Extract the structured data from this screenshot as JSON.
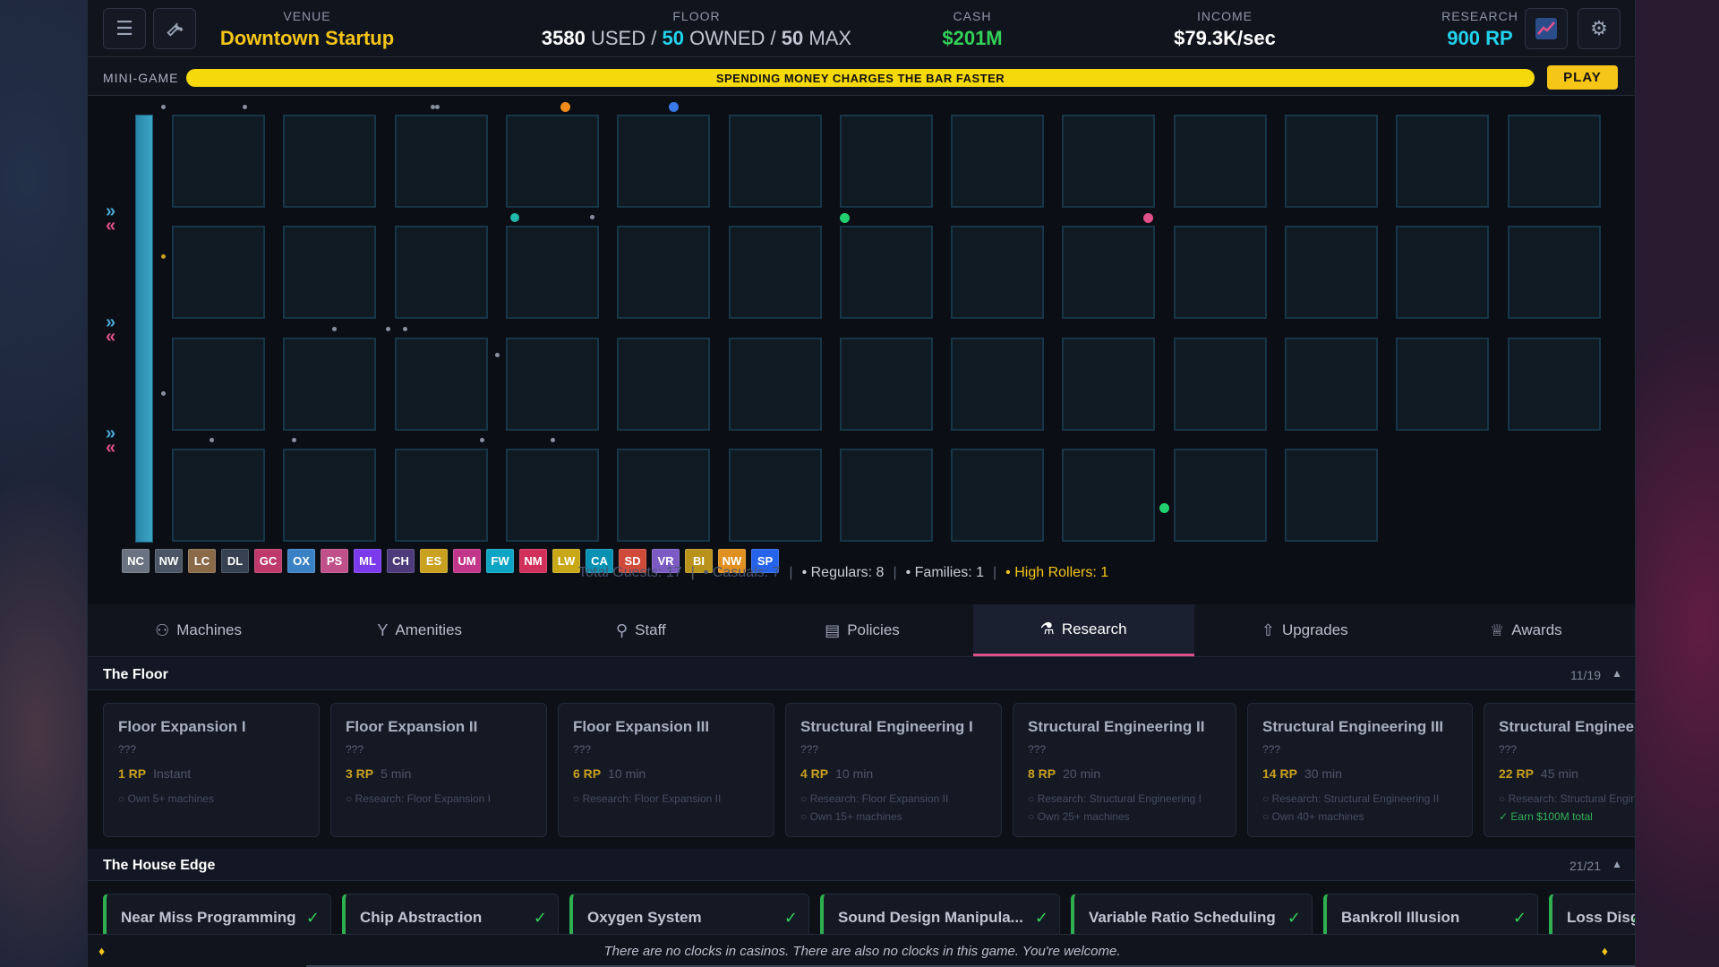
{
  "header": {
    "menu_icon": "hamburger-icon",
    "tools_icon": "wrench-icon",
    "chart_icon": "line-chart-icon",
    "settings_icon": "gear-icon",
    "venue": {
      "label": "VENUE",
      "value": "Downtown Startup"
    },
    "floor": {
      "label": "FLOOR",
      "used": "3580",
      "used_label": "USED /",
      "owned": "50",
      "owned_label": "OWNED /",
      "max": "50",
      "max_label": "MAX"
    },
    "cash": {
      "label": "CASH",
      "value": "$201M"
    },
    "income": {
      "label": "INCOME",
      "value": "$79.3K/sec"
    },
    "research": {
      "label": "RESEARCH",
      "value": "900 RP"
    }
  },
  "minigame": {
    "label": "MINI-GAME",
    "bar_text": "SPENDING MONEY CHARGES THE BAR FASTER",
    "play_label": "PLAY",
    "bar_color": "#f5d90a"
  },
  "floor_grid": {
    "rows": 4,
    "cols_full": 13,
    "last_row_cols": 11,
    "machine_chips": [
      {
        "code": "NC",
        "color": "#6b7280"
      },
      {
        "code": "NW",
        "color": "#4b5563"
      },
      {
        "code": "LC",
        "color": "#8b6a4a"
      },
      {
        "code": "DL",
        "color": "#374151"
      },
      {
        "code": "GC",
        "color": "#be3a6a"
      },
      {
        "code": "OX",
        "color": "#3b82c4"
      },
      {
        "code": "PS",
        "color": "#c0508a"
      },
      {
        "code": "ML",
        "color": "#7c3aed"
      },
      {
        "code": "CH",
        "color": "#4c3a7a"
      },
      {
        "code": "ES",
        "color": "#c9a020"
      },
      {
        "code": "UM",
        "color": "#c2368a"
      },
      {
        "code": "FW",
        "color": "#0ea5c4"
      },
      {
        "code": "NM",
        "color": "#d0305a"
      },
      {
        "code": "LW",
        "color": "#c9a818"
      },
      {
        "code": "CA",
        "color": "#0891b2"
      },
      {
        "code": "SD",
        "color": "#d04a3a"
      },
      {
        "code": "VR",
        "color": "#7c5ac4"
      },
      {
        "code": "BI",
        "color": "#b8921a"
      },
      {
        "code": "NW",
        "color": "#e09020"
      },
      {
        "code": "SP",
        "color": "#2563eb"
      }
    ],
    "guests": {
      "total": "Total Guests: 17",
      "casuals": "• Casuals: 7",
      "regulars": "• Regulars: 8",
      "families": "• Families: 1",
      "high_rollers": "• High Rollers: 1"
    }
  },
  "tabs": [
    {
      "label": "Machines",
      "icon": "slot-machine-icon"
    },
    {
      "label": "Amenities",
      "icon": "cocktail-icon"
    },
    {
      "label": "Staff",
      "icon": "person-icon"
    },
    {
      "label": "Policies",
      "icon": "clipboard-icon"
    },
    {
      "label": "Research",
      "icon": "flask-icon",
      "active": true
    },
    {
      "label": "Upgrades",
      "icon": "arrow-up-icon"
    },
    {
      "label": "Awards",
      "icon": "trophy-icon"
    }
  ],
  "sections": {
    "floor": {
      "title": "The Floor",
      "count": "11/19",
      "cards": [
        {
          "title": "Floor Expansion I",
          "desc": "???",
          "rp": "1 RP",
          "time": "Instant",
          "reqs": [
            "○ Own 5+ machines"
          ]
        },
        {
          "title": "Floor Expansion II",
          "desc": "???",
          "rp": "3 RP",
          "time": "5 min",
          "reqs": [
            "○ Research: Floor Expansion I"
          ]
        },
        {
          "title": "Floor Expansion III",
          "desc": "???",
          "rp": "6 RP",
          "time": "10 min",
          "reqs": [
            "○ Research: Floor Expansion II"
          ]
        },
        {
          "title": "Structural Engineering I",
          "desc": "???",
          "rp": "4 RP",
          "time": "10 min",
          "reqs": [
            "○ Research: Floor Expansion II",
            "○ Own 15+ machines"
          ]
        },
        {
          "title": "Structural Engineering II",
          "desc": "???",
          "rp": "8 RP",
          "time": "20 min",
          "reqs": [
            "○ Research: Structural Engineering I",
            "○ Own 25+ machines"
          ]
        },
        {
          "title": "Structural Engineering III",
          "desc": "???",
          "rp": "14 RP",
          "time": "30 min",
          "reqs": [
            "○ Research: Structural Engineering II",
            "○ Own 40+ machines"
          ]
        },
        {
          "title": "Structural Engineering IV",
          "desc": "???",
          "rp": "22 RP",
          "time": "45 min",
          "reqs": [
            "○ Research: Structural Engineering III"
          ],
          "req_ok": "✓ Earn $100M total"
        }
      ]
    },
    "house_edge": {
      "title": "The House Edge",
      "count": "21/21",
      "cards": [
        {
          "title": "Near Miss Programming"
        },
        {
          "title": "Chip Abstraction"
        },
        {
          "title": "Oxygen System"
        },
        {
          "title": "Sound Design Manipula..."
        },
        {
          "title": "Variable Ratio Scheduling"
        },
        {
          "title": "Bankroll Illusion"
        },
        {
          "title": "Loss Disguised as Win"
        }
      ]
    }
  },
  "footer": {
    "text": "There are no clocks in casinos. There are also no clocks in this game. You're welcome."
  }
}
